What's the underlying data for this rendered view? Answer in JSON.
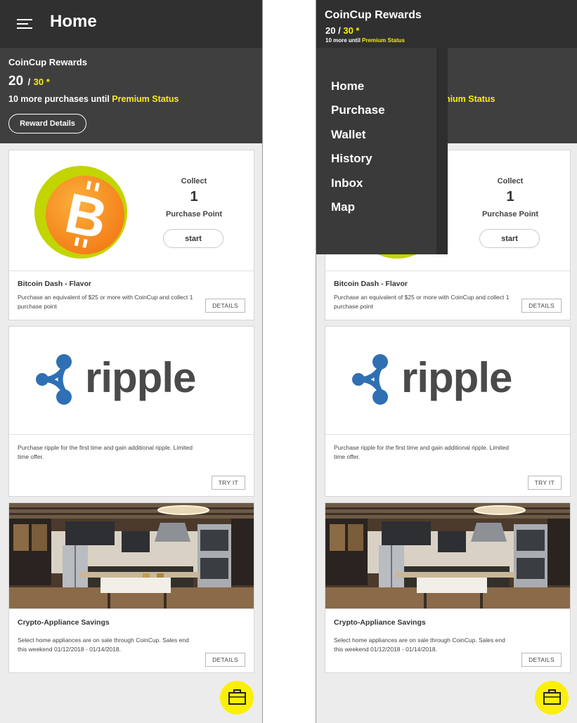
{
  "header": {
    "title": "Home"
  },
  "rewards": {
    "title": "CoinCup Rewards",
    "current_points": "20",
    "separator": "/",
    "target_points": "30 *",
    "status_prefix": "10 more purchases until",
    "status_highlight": "Premium Status",
    "details_button": "Reward Details"
  },
  "cards": [
    {
      "collect_label": "Collect",
      "collect_value": "1",
      "collect_unit": "Purchase Point",
      "start_button": "start",
      "title": "Bitcoin Dash - Flavor",
      "description": "Purchase an equivalent of $25 or more with CoinCup and collect 1 purchase point",
      "button": "DETAILS",
      "logo_symbol": "B"
    },
    {
      "logo_text": "ripple",
      "description": "Purchase ripple for the first time and gain additional ripple. Limited time offer.",
      "button": "TRY IT"
    },
    {
      "title": "Crypto-Appliance Savings",
      "description": "Select home appliances are on sale through CoinCup. Sales end this weekend 01/12/2018 - 01/14/2018.",
      "button": "DETAILS"
    }
  ],
  "drawer": {
    "title": "CoinCup Rewards",
    "current_points": "20",
    "separator": "/",
    "target_points": "30 *",
    "status_prefix": "10 more until",
    "status_highlight": "Premium Status",
    "menu": [
      {
        "label": "Home"
      },
      {
        "label": "Purchase"
      },
      {
        "label": "Wallet"
      },
      {
        "label": "History"
      },
      {
        "label": "Inbox"
      },
      {
        "label": "Map"
      }
    ]
  },
  "colors": {
    "accent_yellow": "#f7ec13",
    "header_dark": "#303030",
    "rewards_bg": "#3f3f3f",
    "bitcoin_orange": "#f7931a",
    "bitcoin_ring": "#c2d500",
    "ripple_blue": "#2f6fb3",
    "ripple_text": "#4a4a4a"
  },
  "icons": {
    "menu": "hamburger-icon",
    "fab": "briefcase-icon"
  }
}
